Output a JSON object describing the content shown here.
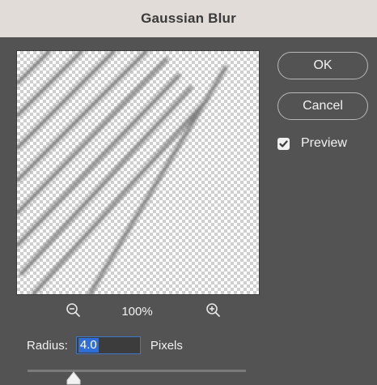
{
  "dialog": {
    "title": "Gaussian Blur"
  },
  "buttons": {
    "ok_label": "OK",
    "cancel_label": "Cancel"
  },
  "preview_toggle": {
    "label": "Preview",
    "checked": true
  },
  "zoom": {
    "level": "100%",
    "zoom_out_icon": "zoom-out-icon",
    "zoom_in_icon": "zoom-in-icon"
  },
  "radius": {
    "label": "Radius:",
    "value": "4.0",
    "units": "Pixels",
    "slider_fraction": 0.2
  },
  "colors": {
    "title_bar": "#e2dcd9",
    "dialog_bg": "#535353",
    "selection": "#2e6ed6",
    "input_border": "#3e78c8"
  }
}
